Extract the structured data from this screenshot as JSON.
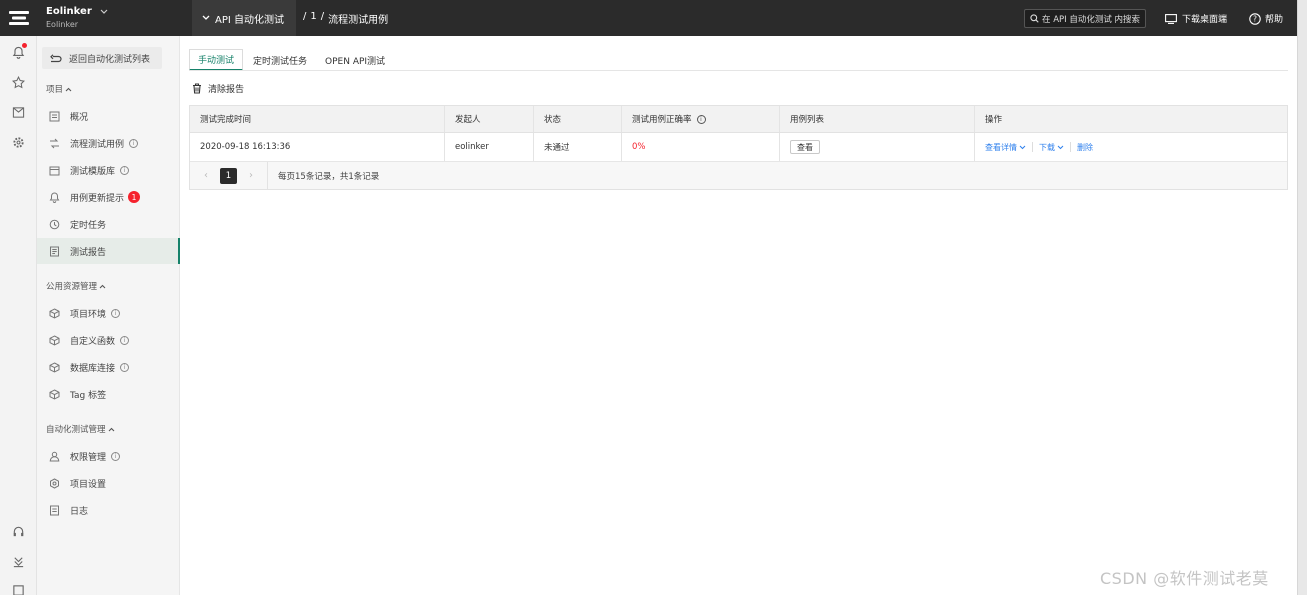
{
  "colors": {
    "accent": "#16826a",
    "topbar": "#2b2b2b",
    "link": "#2f80ed",
    "danger": "#f5222d"
  },
  "brand": {
    "name": "Eolinker",
    "sub": "Eolinker"
  },
  "header": {
    "crumb_main": "API 自动化测试",
    "crumb_num": "1",
    "crumb_sep1": "/",
    "crumb_sep2": "/",
    "crumb_page": "流程测试用例",
    "search_placeholder": "在 API 自动化测试 内搜索",
    "download_label": "下载桌面端",
    "help_label": "帮助"
  },
  "sidebar": {
    "back_label": "返回自动化测试列表",
    "sections": [
      {
        "title": "项目"
      },
      {
        "title": "公用资源管理"
      },
      {
        "title": "自动化测试管理"
      }
    ],
    "items": [
      {
        "label": "概况",
        "icon": "overview-icon"
      },
      {
        "label": "流程测试用例",
        "icon": "flow-icon",
        "info": "i"
      },
      {
        "label": "测试模版库",
        "icon": "template-icon",
        "info": "i"
      },
      {
        "label": "用例更新提示",
        "icon": "bell-icon",
        "badge": "1"
      },
      {
        "label": "定时任务",
        "icon": "clock-icon"
      },
      {
        "label": "测试报告",
        "icon": "report-icon",
        "active": true
      },
      {
        "label": "项目环境",
        "icon": "cube-icon",
        "info": "i"
      },
      {
        "label": "自定义函数",
        "icon": "cube-icon",
        "info": "i"
      },
      {
        "label": "数据库连接",
        "icon": "cube-icon",
        "info": "i"
      },
      {
        "label": "Tag 标签",
        "icon": "cube-icon"
      },
      {
        "label": "权限管理",
        "icon": "user-icon",
        "info": "i"
      },
      {
        "label": "项目设置",
        "icon": "settings-icon"
      },
      {
        "label": "日志",
        "icon": "log-icon"
      }
    ]
  },
  "main": {
    "tabs": [
      {
        "label": "手动测试",
        "active": true
      },
      {
        "label": "定时测试任务"
      },
      {
        "label": "OPEN API测试"
      }
    ],
    "clear_report": "清除报告",
    "table": {
      "headers": [
        "测试完成时间",
        "发起人",
        "状态",
        "测试用例正确率",
        "用例列表",
        "操作"
      ],
      "header_info": "i",
      "rows": [
        {
          "time": "2020-09-18 16:13:36",
          "initiator": "eolinker",
          "status": "未通过",
          "accuracy": "0%",
          "case_list_btn": "查看",
          "ops": {
            "detail": "查看详情",
            "download": "下载",
            "delete": "删除"
          }
        }
      ]
    },
    "pagination": {
      "current": "1",
      "summary": "每页15条记录，共1条记录"
    }
  },
  "watermark": "CSDN @软件测试老莫"
}
